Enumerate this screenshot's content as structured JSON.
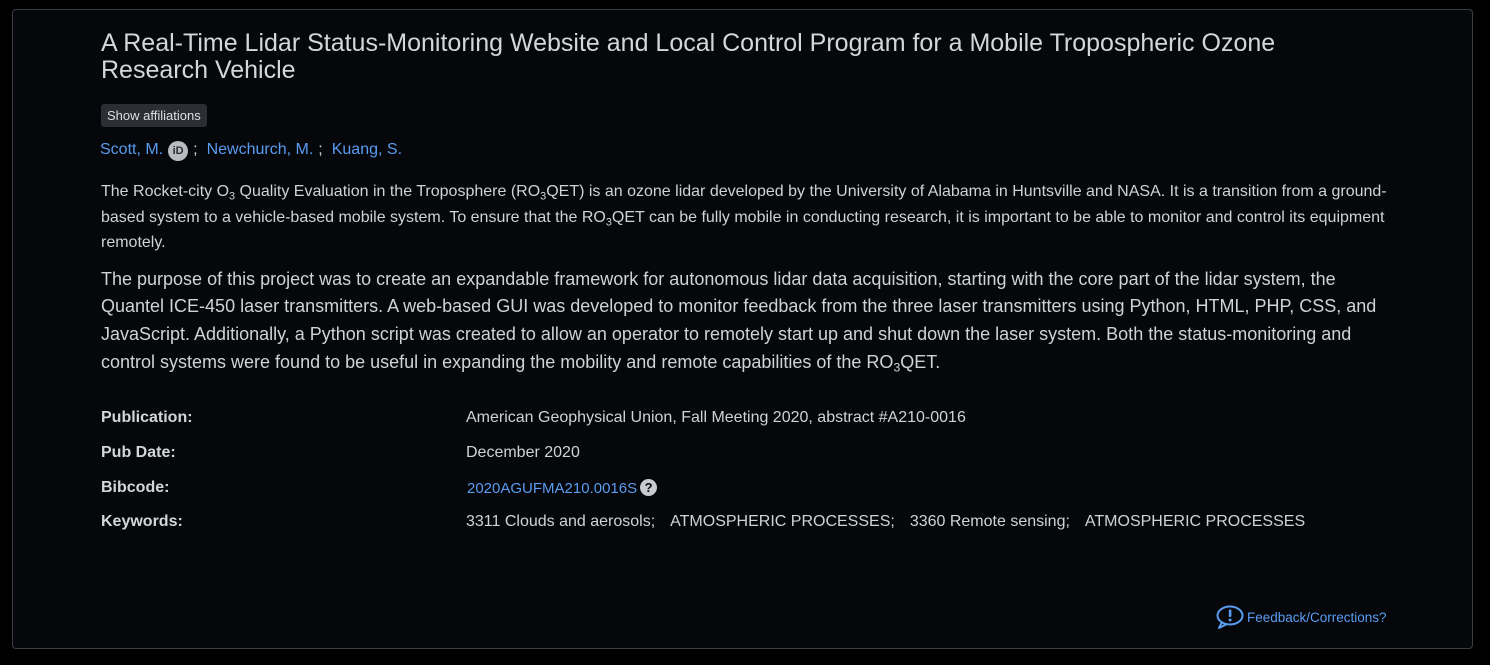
{
  "title": "A Real-Time Lidar Status-Monitoring Website and Local Control Program for a Mobile Tropospheric Ozone Research Vehicle",
  "show_affiliations_label": "Show affiliations",
  "authors": [
    {
      "name": "Scott, M.",
      "has_orcid": true
    },
    {
      "name": "Newchurch, M.",
      "has_orcid": false
    },
    {
      "name": "Kuang, S.",
      "has_orcid": false
    }
  ],
  "orcid_icon_text": "iD",
  "author_separator": ";",
  "abstract": {
    "p1_a": "The Rocket-city O",
    "p1_sub1": "3",
    "p1_b": " Quality Evaluation in the Troposphere (RO",
    "p1_sub2": "3",
    "p1_c": "QET) is an ozone lidar developed by the University of Alabama in Huntsville and NASA. It is a transition from a ground-based system to a vehicle-based mobile system. To ensure that the RO",
    "p1_sub3": "3",
    "p1_d": "QET can be fully mobile in conducting research, it is important to be able to monitor and control its equipment remotely.",
    "p2_a": "The purpose of this project was to create an expandable framework for autonomous lidar data acquisition, starting with the core part of the lidar system, the Quantel ICE-450 laser transmitters. A web-based GUI was developed to monitor feedback from the three laser transmitters using Python, HTML, PHP, CSS, and JavaScript. Additionally, a Python script was created to allow an operator to remotely start up and shut down the laser system. Both the status-monitoring and control systems were found to be useful in expanding the mobility and remote capabilities of the RO",
    "p2_sub": "3",
    "p2_b": "QET."
  },
  "meta": {
    "publication_label": "Publication:",
    "publication_value": "American Geophysical Union, Fall Meeting 2020, abstract #A210-0016",
    "pubdate_label": "Pub Date:",
    "pubdate_value": "December 2020",
    "bibcode_label": "Bibcode:",
    "bibcode_value": "2020AGUFMA210.0016S",
    "bibcode_help_glyph": "?",
    "keywords_label": "Keywords:",
    "keywords": [
      "3311 Clouds and aerosols;",
      "ATMOSPHERIC PROCESSES;",
      "3360 Remote sensing;",
      "ATMOSPHERIC PROCESSES"
    ]
  },
  "feedback_label": "Feedback/Corrections?",
  "colors": {
    "background": "#05070b",
    "text": "#d0d3d6",
    "link": "#5a9cf0",
    "button_bg": "#2b2f35",
    "border": "#3a3f46"
  },
  "icons": {
    "orcid": "orcid-icon",
    "help": "question-circle-icon",
    "feedback": "comment-exclamation-icon"
  }
}
